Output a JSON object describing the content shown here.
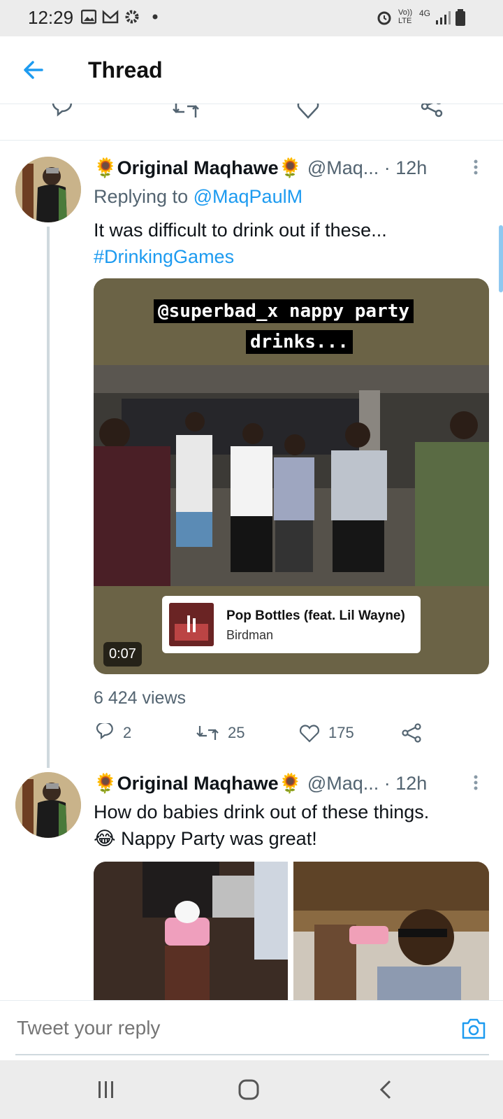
{
  "status_bar": {
    "time": "12:29",
    "network": "Vo)) LTE",
    "network_type": "4G",
    "icons": [
      "image-icon",
      "gmail-icon",
      "gear-icon",
      "dot-icon",
      "alarm-icon",
      "signal-icon",
      "battery-icon"
    ]
  },
  "header": {
    "title": "Thread",
    "back_icon": "arrow-left-icon"
  },
  "tweets": [
    {
      "name": "Original Maqhawe",
      "handle": "@Maq...",
      "time": "· 12h",
      "replying_label": "Replying to",
      "replying_to": "@MaqPaulM",
      "text": "It was difficult to drink out if these...",
      "hashtag": "#DrinkingGames",
      "video": {
        "caption_line1": "@superbad_x nappy party",
        "caption_line2": "drinks...",
        "song_title": "Pop Bottles (feat. Lil Wayne)",
        "song_artist": "Birdman",
        "duration": "0:07"
      },
      "views": "6 424 views",
      "stats": {
        "replies": "2",
        "retweets": "25",
        "likes": "175"
      }
    },
    {
      "name": "Original Maqhawe",
      "handle": "@Maq...",
      "time": "· 12h",
      "text": "How do babies drink out of these things.",
      "text2": "Nappy Party was great!"
    }
  ],
  "reply_bar": {
    "placeholder": "Tweet your reply"
  },
  "colors": {
    "accent": "#1d9bf0",
    "secondary_text": "#536471",
    "video_bg": "#6b6346"
  }
}
